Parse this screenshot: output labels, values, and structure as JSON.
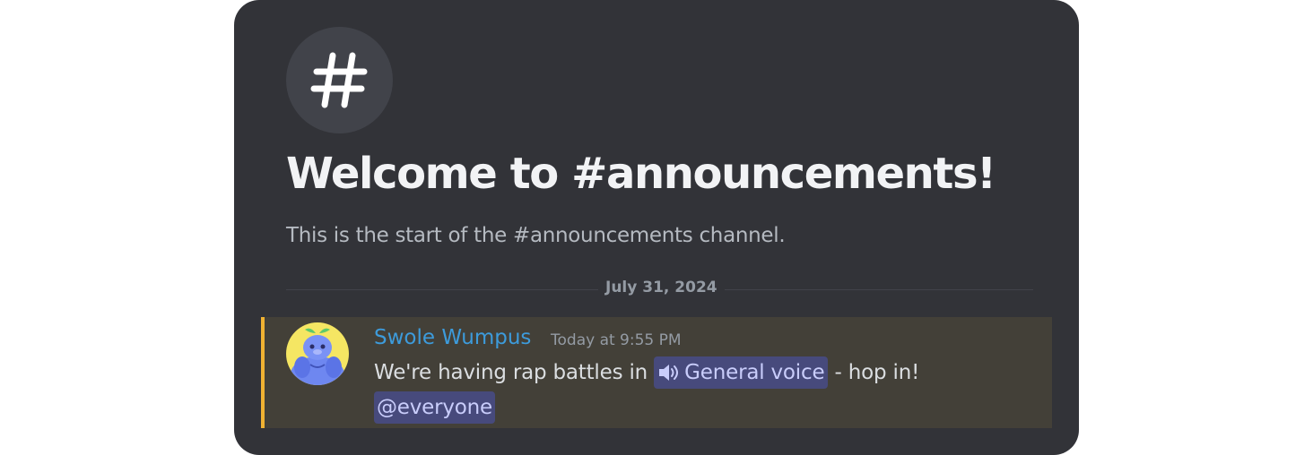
{
  "channel": {
    "icon": "hashtag-icon",
    "welcome_title": "Welcome to #announcements!",
    "welcome_subtitle": "This is the start of the #announcements channel."
  },
  "divider": {
    "date": "July 31, 2024"
  },
  "message": {
    "author": "Swole Wumpus",
    "timestamp": "Today at 9:55 PM",
    "text_before": "We're having rap battles in",
    "channel_mention": {
      "icon": "speaker-icon",
      "label": "General voice"
    },
    "text_after": "- hop in!",
    "mention": "@everyone",
    "avatar": "wumpus-avatar"
  },
  "colors": {
    "card_bg": "#323338",
    "title": "#f2f3f5",
    "muted": "#b5bac1",
    "timestamp": "#949ba4",
    "username": "#3d9bdb",
    "mention_highlight_bg": "#434038",
    "mention_bar": "#f0b232",
    "mention_pill_bg": "#474a7c",
    "mention_pill_text": "#c9cdfb"
  }
}
